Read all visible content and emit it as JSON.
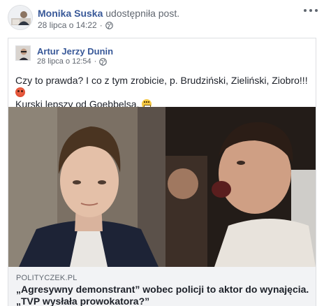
{
  "sharer": {
    "name": "Monika Suska",
    "action": "udostępniła post.",
    "timestamp": "28 lipca o 14:22",
    "separator": "·"
  },
  "original_post": {
    "author": "Artur Jerzy Dunin",
    "timestamp": "28 lipca o 12:54",
    "separator": "·",
    "text_line1": "Czy to prawda? I co z tym zrobicie, p. Brudziński, Zieliński, Ziobro!!!",
    "text_line2": "Kurski lepszy od Goebbelsa."
  },
  "link_preview": {
    "domain": "POLITYCZEK.PL",
    "title": "„Agresywny demonstrant” wobec policji to aktor do wynajęcia. „TVP wysłała prowokatora?”"
  },
  "icons": {
    "privacy": "globe-icon",
    "more": "more-options-icon",
    "emoji_1": "angry-face-emoji",
    "emoji_2": "grimacing-face-emoji"
  },
  "colors": {
    "name_link": "#385898",
    "meta_text": "#616770",
    "link_meta_bg": "#f2f3f5",
    "border": "#dddfe2"
  }
}
